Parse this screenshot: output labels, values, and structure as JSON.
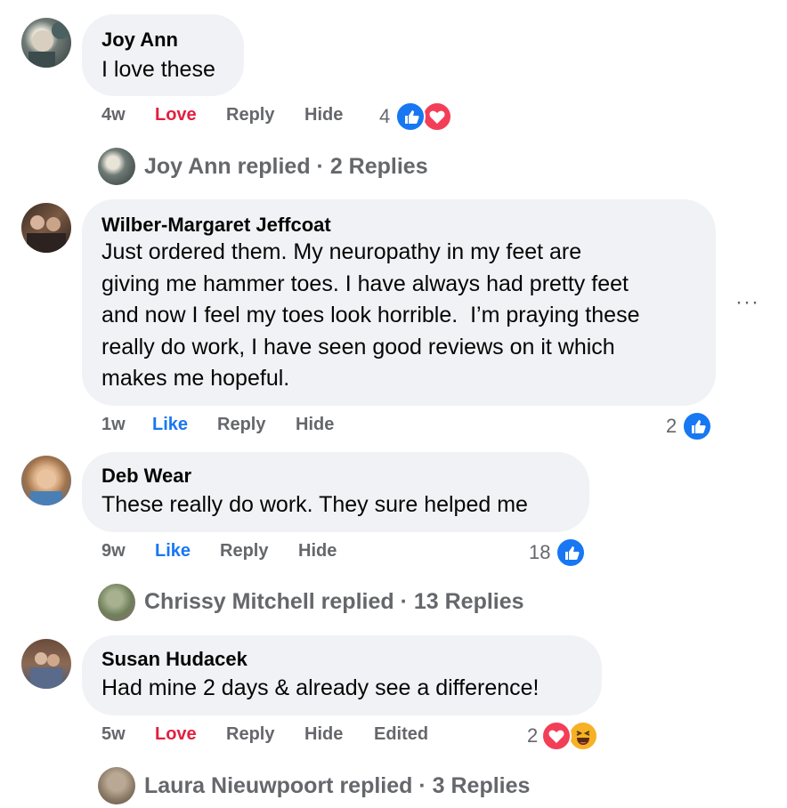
{
  "comments": [
    {
      "author": "Joy Ann",
      "lines": [
        "I love these"
      ],
      "time": "4w",
      "reaction_action": "Love",
      "reply": "Reply",
      "hide": "Hide",
      "reaction_count": "4",
      "reaction_icons": [
        "like-icon",
        "love-icon"
      ]
    },
    {
      "author": "Wilber-Margaret Jeffcoat",
      "lines": [
        "Just ordered them. My neuropathy in my feet are",
        "giving me hammer toes. I have always had pretty feet",
        "and now I feel my toes look horrible.  I’m praying these",
        "really do work, I have seen good reviews on it which",
        "makes me hopeful."
      ],
      "time": "1w",
      "reaction_action": "Like",
      "reply": "Reply",
      "hide": "Hide",
      "reaction_count": "2",
      "reaction_icons": [
        "like-icon"
      ],
      "more_label": "···"
    },
    {
      "author": "Deb Wear",
      "lines": [
        "These really do work. They sure helped me"
      ],
      "time": "9w",
      "reaction_action": "Like",
      "reply": "Reply",
      "hide": "Hide",
      "reaction_count": "18",
      "reaction_icons": [
        "like-icon"
      ]
    },
    {
      "author": "Susan Hudacek",
      "lines": [
        "Had mine 2 days & already see a difference!"
      ],
      "time": "5w",
      "reaction_action": "Love",
      "reply": "Reply",
      "hide": "Hide",
      "edited": "Edited",
      "reaction_count": "2",
      "reaction_icons": [
        "love-icon",
        "haha-icon"
      ]
    }
  ],
  "reply_threads": [
    {
      "text": "Joy Ann replied · 2 Replies"
    },
    {
      "text": "Chrissy Mitchell replied · 13 Replies"
    },
    {
      "text": "Laura Nieuwpoort replied · 3 Replies"
    }
  ],
  "colors": {
    "bubble": "#f0f2f5",
    "meta_text": "#65676b",
    "love_red": "#e41e3f",
    "like_blue": "#1877f2"
  }
}
